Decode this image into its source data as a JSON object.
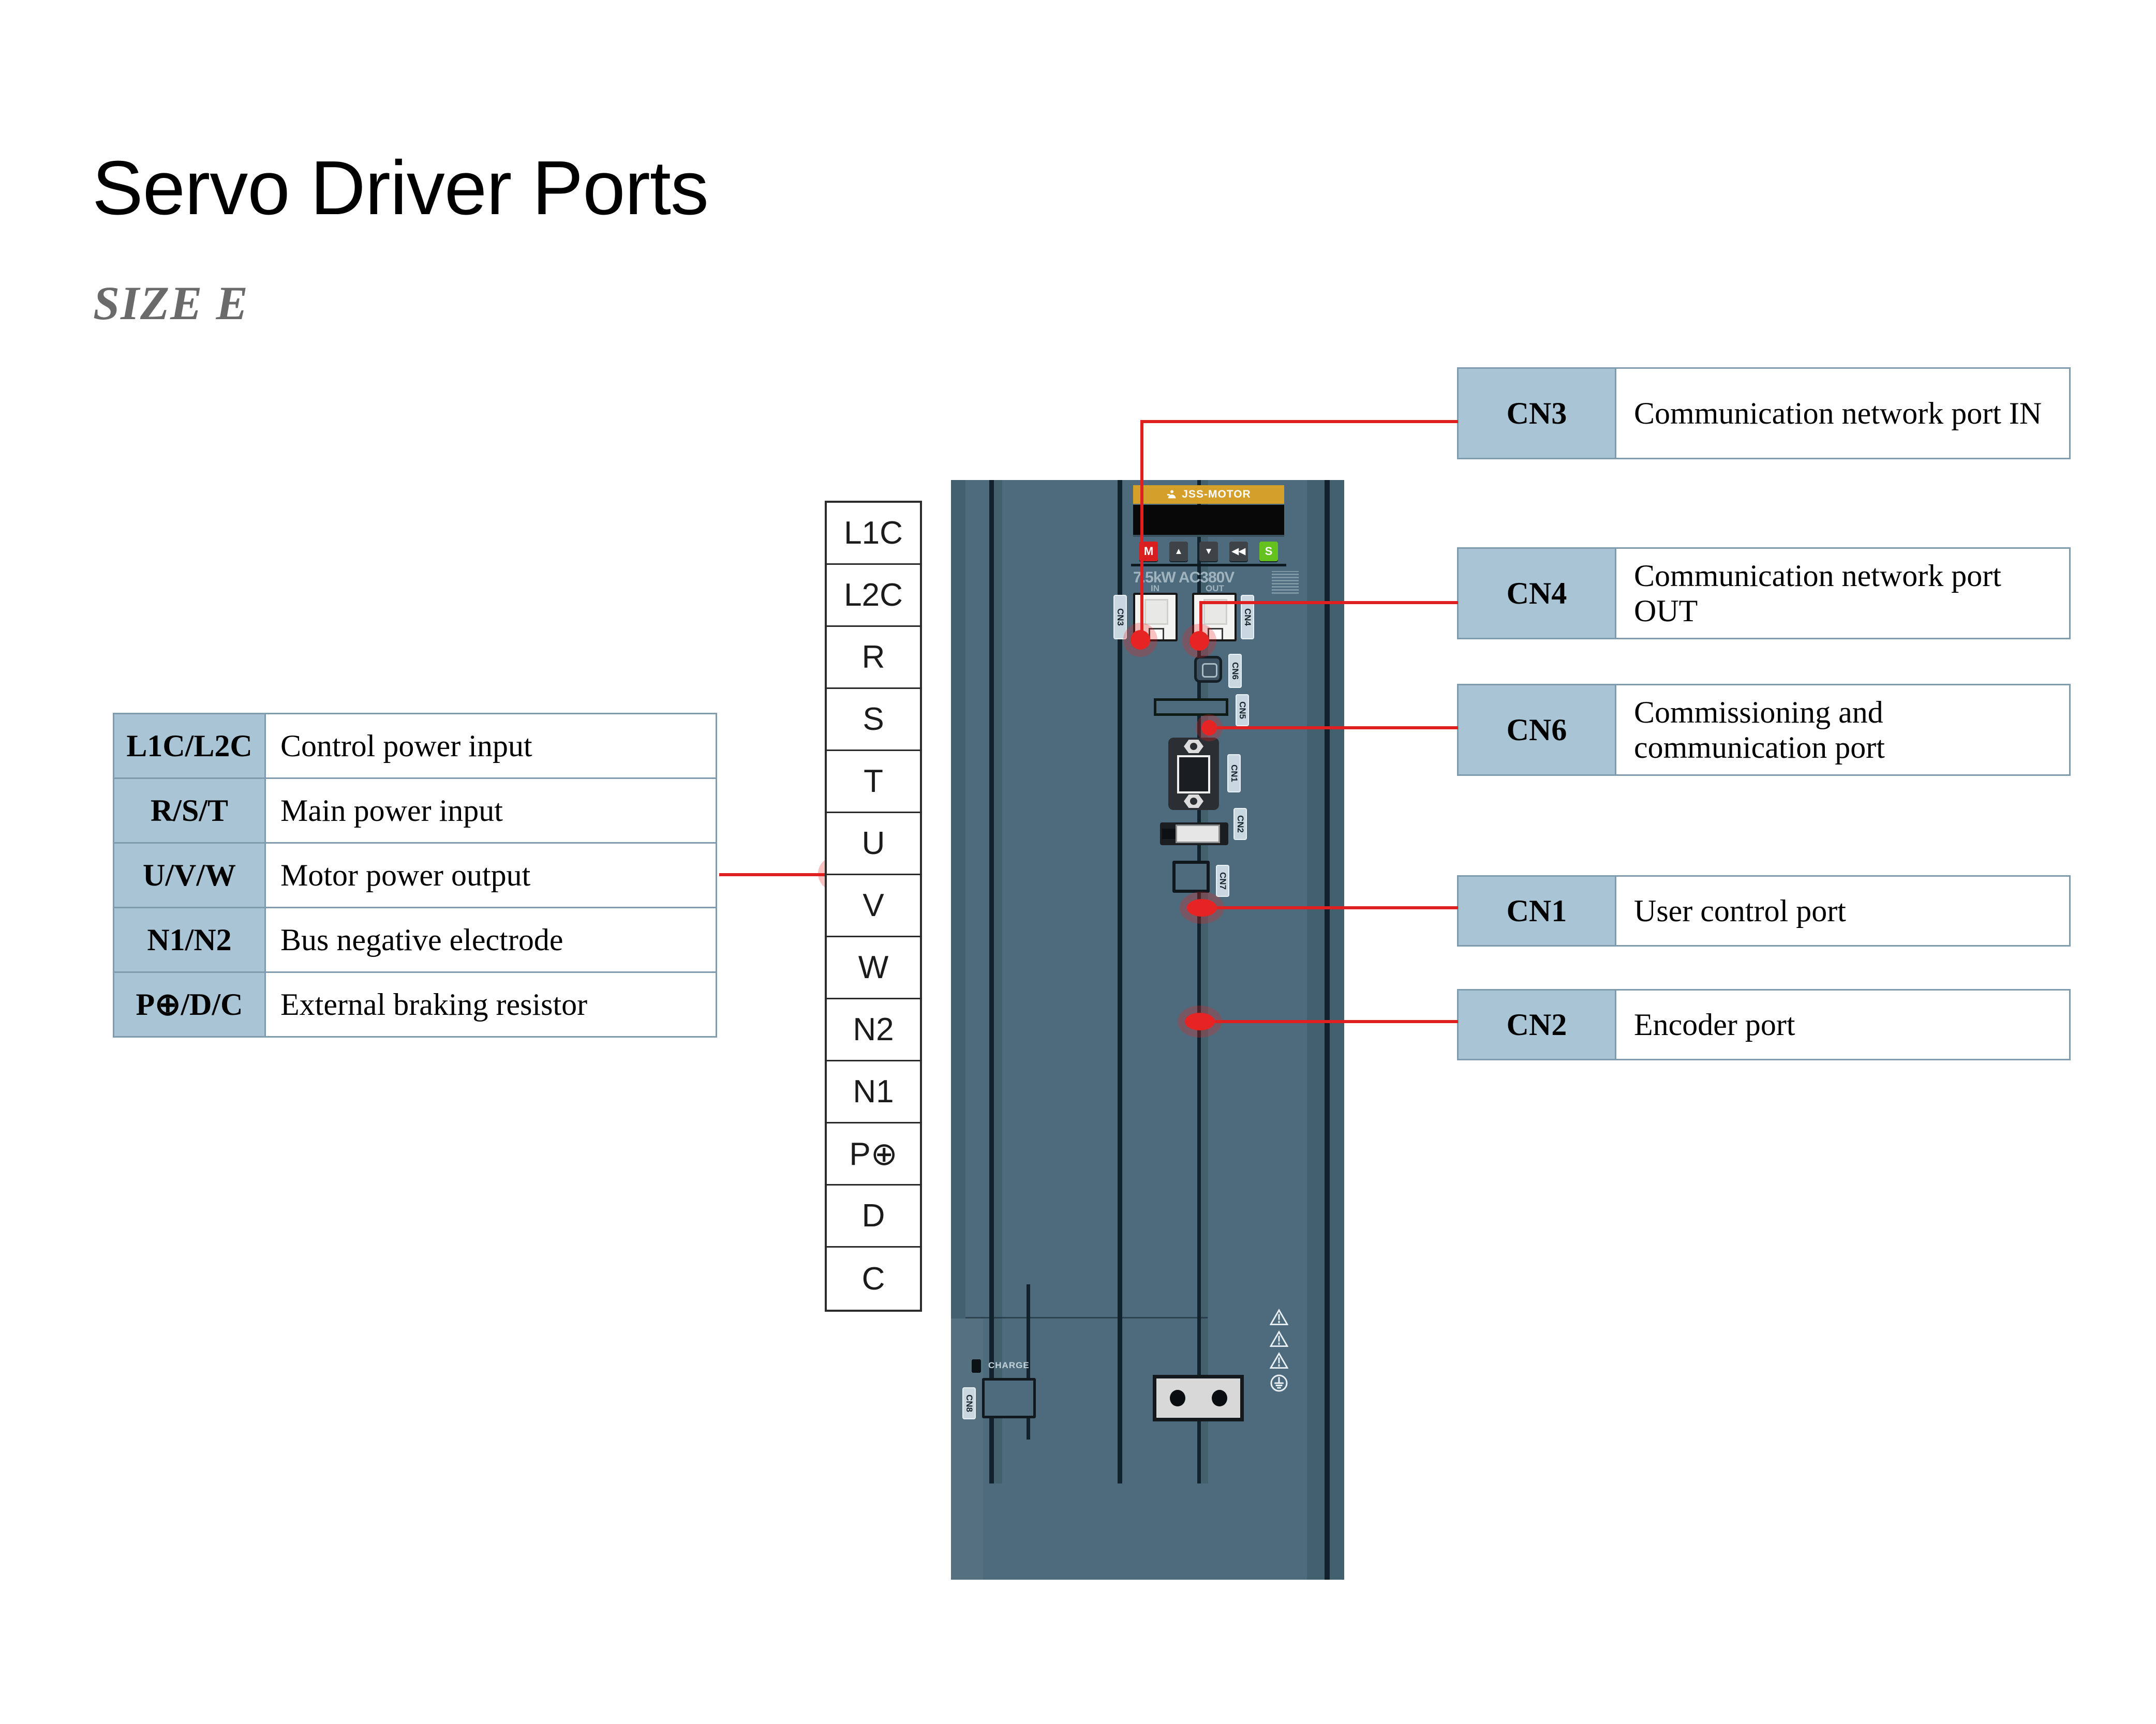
{
  "title": "Servo Driver Ports",
  "subtitle": "SIZE E",
  "colors": {
    "table_header": "#a9c4d4",
    "table_border": "#7f9cae",
    "lead_red": "#e02020",
    "drive_body": "#4e6b7d",
    "brand_orange": "#d4a02a",
    "key_m_red": "#d81e1e",
    "key_s_green": "#64c11e"
  },
  "terminal_function_table": {
    "rows": [
      {
        "key": "L1C/L2C",
        "value": "Control power input"
      },
      {
        "key": "R/S/T",
        "value": "Main power input"
      },
      {
        "key": "U/V/W",
        "value": "Motor power output"
      },
      {
        "key": "N1/N2",
        "value": "Bus negative electrode"
      },
      {
        "key": "P⊕/D/C",
        "value": "External braking resistor"
      }
    ]
  },
  "terminal_strip": {
    "labels": [
      "L1C",
      "L2C",
      "R",
      "S",
      "T",
      "U",
      "V",
      "W",
      "N2",
      "N1",
      "P⊕",
      "D",
      "C"
    ]
  },
  "port_callouts": [
    {
      "key": "CN3",
      "value": "Communication network port IN"
    },
    {
      "key": "CN4",
      "value": "Communication network port OUT"
    },
    {
      "key": "CN6",
      "value": "Commissioning and communication port"
    },
    {
      "key": "CN1",
      "value": "User control port"
    },
    {
      "key": "CN2",
      "value": "Encoder port"
    }
  ],
  "drive": {
    "brand": "JSS-MOTOR",
    "rating": "7.5kW AC380V",
    "port_in_caption": "IN",
    "port_out_caption": "OUT",
    "charge_label": "CHARGE",
    "keypad": [
      {
        "label": "M",
        "style": "red"
      },
      {
        "label": "▲",
        "style": "dark"
      },
      {
        "label": "▼",
        "style": "dark"
      },
      {
        "label": "◀◀",
        "style": "dark"
      },
      {
        "label": "S",
        "style": "green"
      }
    ],
    "port_tags": [
      "CN3",
      "CN4",
      "CN6",
      "CN5",
      "CN1",
      "CN2",
      "CN7",
      "CN8"
    ]
  }
}
